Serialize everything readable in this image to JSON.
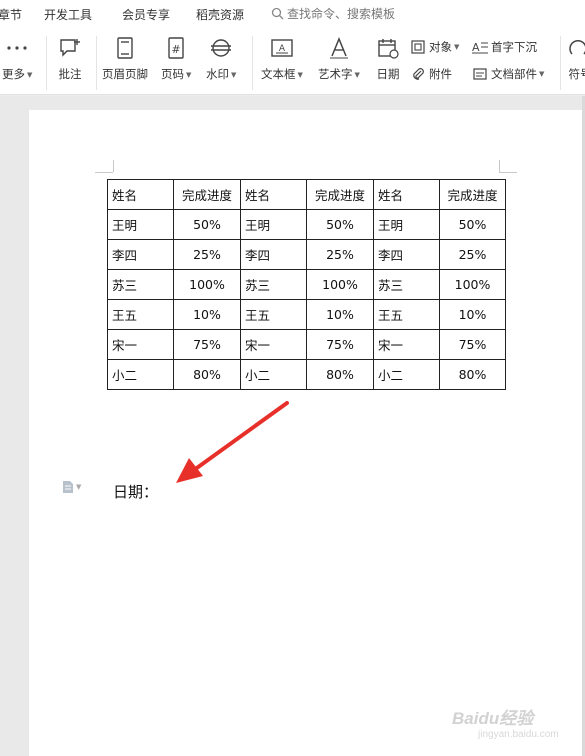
{
  "menu": {
    "items": [
      "章节",
      "开发工具",
      "会员专享",
      "稻壳资源"
    ],
    "search_placeholder": "查找命令、搜索模板"
  },
  "ribbon": {
    "more": "更多",
    "comment": "批注",
    "header_footer": "页眉页脚",
    "page_number": "页码",
    "watermark": "水印",
    "textbox": "文本框",
    "wordart": "艺术字",
    "date": "日期",
    "object": "对象",
    "attachment": "附件",
    "dropcap": "首字下沉",
    "doc_parts": "文档部件",
    "symbol": "符号"
  },
  "table": {
    "headers": [
      "姓名",
      "完成进度",
      "姓名",
      "完成进度",
      "姓名",
      "完成进度"
    ],
    "rows": [
      [
        "王明",
        "50%",
        "王明",
        "50%",
        "王明",
        "50%"
      ],
      [
        "李四",
        "25%",
        "李四",
        "25%",
        "李四",
        "25%"
      ],
      [
        "苏三",
        "100%",
        "苏三",
        "100%",
        "苏三",
        "100%"
      ],
      [
        "王五",
        "10%",
        "王五",
        "10%",
        "王五",
        "10%"
      ],
      [
        "宋一",
        "75%",
        "宋一",
        "75%",
        "宋一",
        "75%"
      ],
      [
        "小二",
        "80%",
        "小二",
        "80%",
        "小二",
        "80%"
      ]
    ]
  },
  "document": {
    "date_label": "日期："
  },
  "watermark": {
    "text": "Baidu经验",
    "url": "jingyan.baidu.com"
  },
  "colors": {
    "arrow": "#e8302b",
    "ribbon_bg": "#ffffff",
    "doc_bg": "#e9e9e9"
  }
}
